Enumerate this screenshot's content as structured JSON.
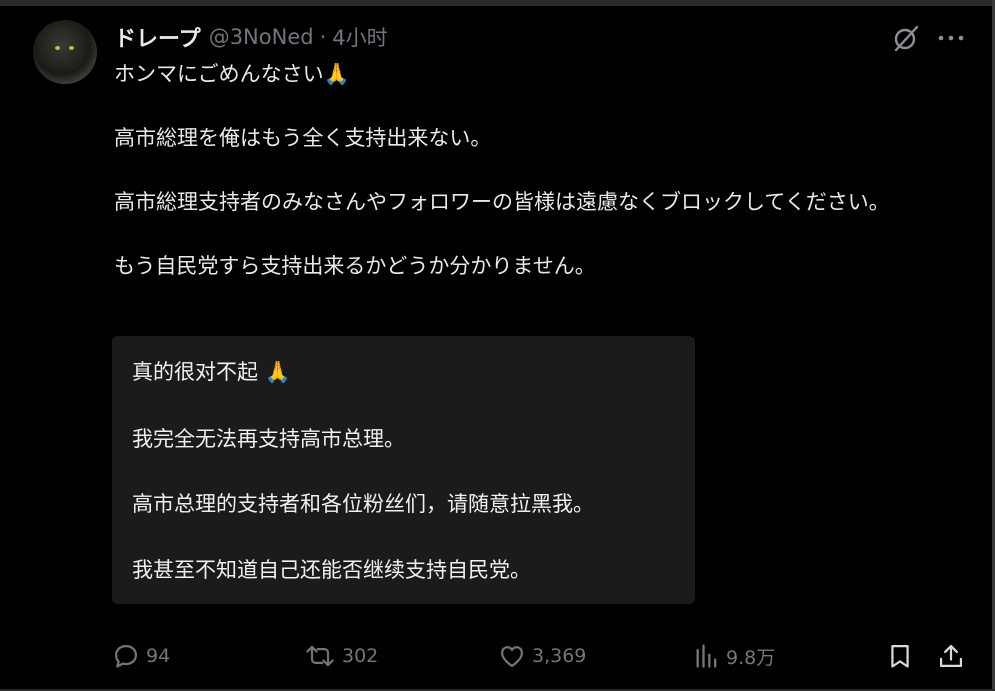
{
  "author": {
    "display_name": "ドレープ",
    "handle": "@3NoNed",
    "separator": "·",
    "time": "4小时"
  },
  "post": {
    "paragraphs": [
      "ホンマにごめんなさい🙏",
      "高市総理を俺はもう全く支持出来ない。",
      "高市総理支持者のみなさんやフォロワーの皆様は遠慮なくブロックしてください。",
      "もう自民党すら支持出来るかどうか分かりません。"
    ]
  },
  "translation": {
    "paragraphs": [
      "真的很对不起 🙏",
      "我完全无法再支持高市总理。",
      "高市总理的支持者和各位粉丝们，请随意拉黑我。",
      "我甚至不知道自己还能否继续支持自民党。"
    ]
  },
  "metrics": {
    "replies": "94",
    "reposts": "302",
    "likes": "3,369",
    "views": "9.8万"
  },
  "icons": {
    "grok": "grok-icon",
    "more": "more-icon",
    "reply": "reply-icon",
    "repost": "repost-icon",
    "like": "like-icon",
    "views": "views-icon",
    "bookmark": "bookmark-icon",
    "share": "share-icon"
  },
  "colors": {
    "background": "#000000",
    "text": "#e7e9ea",
    "secondary": "#71767b",
    "translation_bg": "#1c1a1a"
  }
}
